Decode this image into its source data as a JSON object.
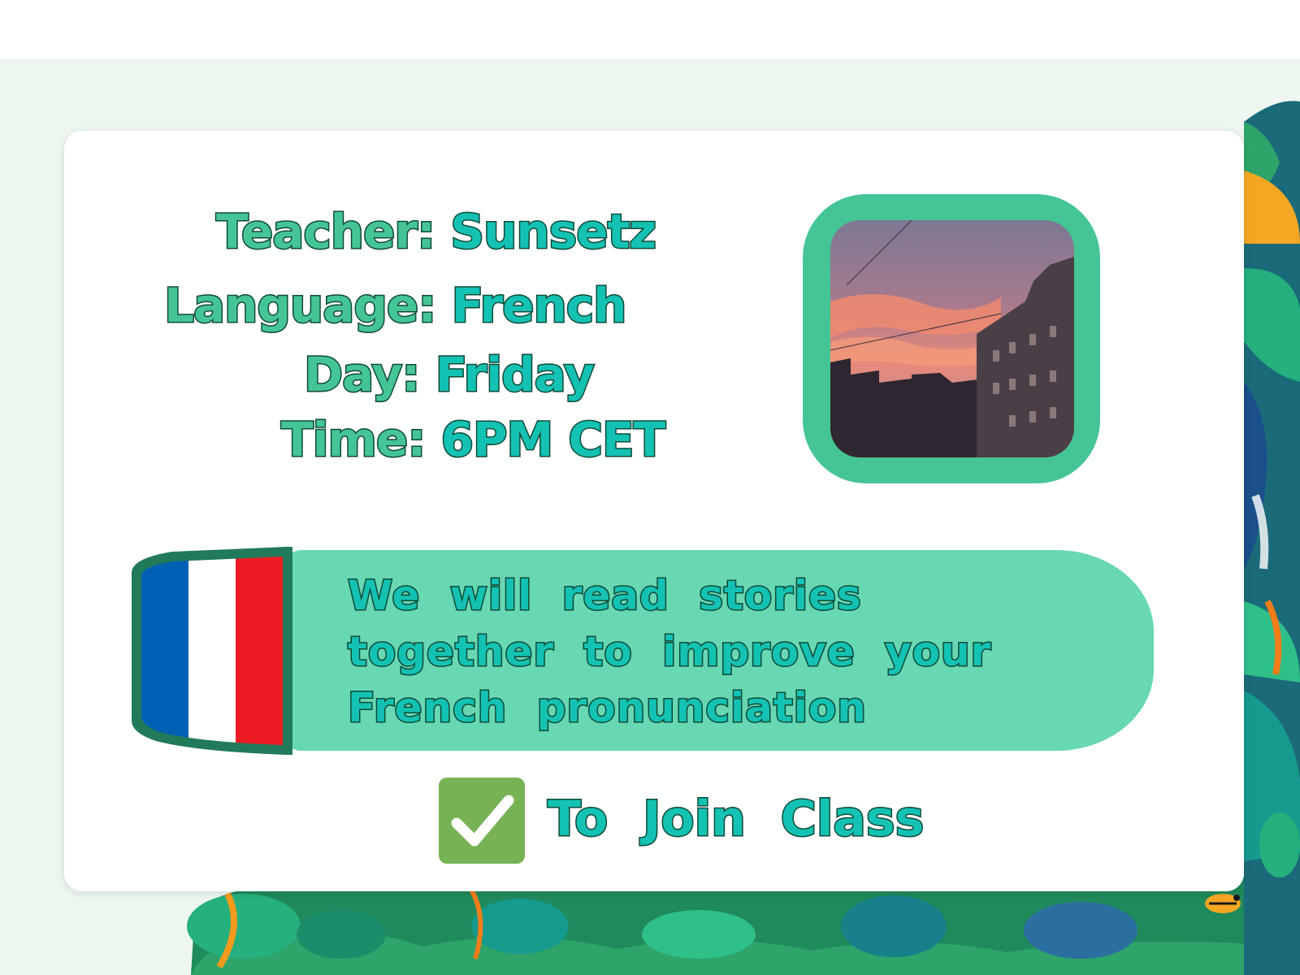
{
  "class_card": {
    "teacher": {
      "label": "Teacher:",
      "value": "Sunsetz"
    },
    "language": {
      "label": "Language:",
      "value": "French"
    },
    "day": {
      "label": "Day:",
      "value": "Friday"
    },
    "time": {
      "label": "Time:",
      "value": "6PM CET"
    },
    "description": "We will read stories together to improve your French pronunciation",
    "join": {
      "icon": "check-mark-icon",
      "label": "To Join Class"
    },
    "photo": {
      "subject": "sunset-over-city-buildings"
    },
    "flag": {
      "name": "france-flag",
      "colors": [
        "#0061b4",
        "#ffffff",
        "#ed1c24"
      ]
    }
  },
  "colors": {
    "label_green": "#45c595",
    "value_teal": "#14c2b3",
    "text_outline": "#0f4a38",
    "banner": "#67d8b3",
    "frame": "#45c595",
    "check_box": "#77b255",
    "page_background": "#edf7f0"
  }
}
